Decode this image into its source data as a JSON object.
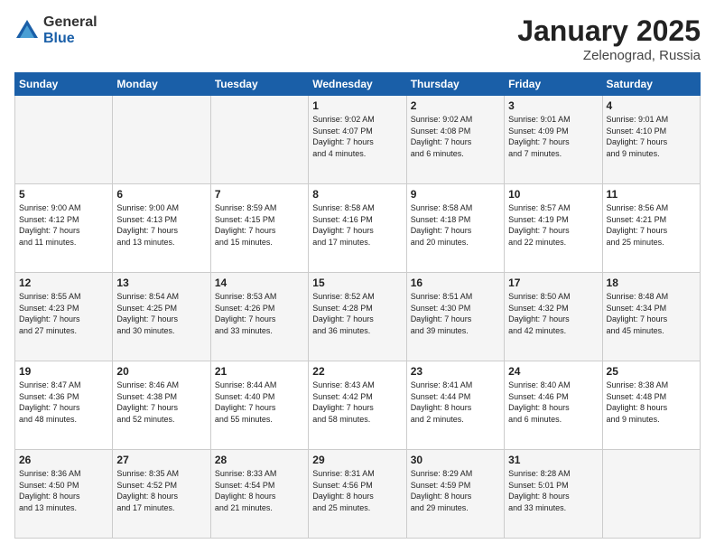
{
  "logo": {
    "general": "General",
    "blue": "Blue"
  },
  "title": "January 2025",
  "location": "Zelenograd, Russia",
  "days_of_week": [
    "Sunday",
    "Monday",
    "Tuesday",
    "Wednesday",
    "Thursday",
    "Friday",
    "Saturday"
  ],
  "weeks": [
    [
      {
        "day": "",
        "info": ""
      },
      {
        "day": "",
        "info": ""
      },
      {
        "day": "",
        "info": ""
      },
      {
        "day": "1",
        "info": "Sunrise: 9:02 AM\nSunset: 4:07 PM\nDaylight: 7 hours\nand 4 minutes."
      },
      {
        "day": "2",
        "info": "Sunrise: 9:02 AM\nSunset: 4:08 PM\nDaylight: 7 hours\nand 6 minutes."
      },
      {
        "day": "3",
        "info": "Sunrise: 9:01 AM\nSunset: 4:09 PM\nDaylight: 7 hours\nand 7 minutes."
      },
      {
        "day": "4",
        "info": "Sunrise: 9:01 AM\nSunset: 4:10 PM\nDaylight: 7 hours\nand 9 minutes."
      }
    ],
    [
      {
        "day": "5",
        "info": "Sunrise: 9:00 AM\nSunset: 4:12 PM\nDaylight: 7 hours\nand 11 minutes."
      },
      {
        "day": "6",
        "info": "Sunrise: 9:00 AM\nSunset: 4:13 PM\nDaylight: 7 hours\nand 13 minutes."
      },
      {
        "day": "7",
        "info": "Sunrise: 8:59 AM\nSunset: 4:15 PM\nDaylight: 7 hours\nand 15 minutes."
      },
      {
        "day": "8",
        "info": "Sunrise: 8:58 AM\nSunset: 4:16 PM\nDaylight: 7 hours\nand 17 minutes."
      },
      {
        "day": "9",
        "info": "Sunrise: 8:58 AM\nSunset: 4:18 PM\nDaylight: 7 hours\nand 20 minutes."
      },
      {
        "day": "10",
        "info": "Sunrise: 8:57 AM\nSunset: 4:19 PM\nDaylight: 7 hours\nand 22 minutes."
      },
      {
        "day": "11",
        "info": "Sunrise: 8:56 AM\nSunset: 4:21 PM\nDaylight: 7 hours\nand 25 minutes."
      }
    ],
    [
      {
        "day": "12",
        "info": "Sunrise: 8:55 AM\nSunset: 4:23 PM\nDaylight: 7 hours\nand 27 minutes."
      },
      {
        "day": "13",
        "info": "Sunrise: 8:54 AM\nSunset: 4:25 PM\nDaylight: 7 hours\nand 30 minutes."
      },
      {
        "day": "14",
        "info": "Sunrise: 8:53 AM\nSunset: 4:26 PM\nDaylight: 7 hours\nand 33 minutes."
      },
      {
        "day": "15",
        "info": "Sunrise: 8:52 AM\nSunset: 4:28 PM\nDaylight: 7 hours\nand 36 minutes."
      },
      {
        "day": "16",
        "info": "Sunrise: 8:51 AM\nSunset: 4:30 PM\nDaylight: 7 hours\nand 39 minutes."
      },
      {
        "day": "17",
        "info": "Sunrise: 8:50 AM\nSunset: 4:32 PM\nDaylight: 7 hours\nand 42 minutes."
      },
      {
        "day": "18",
        "info": "Sunrise: 8:48 AM\nSunset: 4:34 PM\nDaylight: 7 hours\nand 45 minutes."
      }
    ],
    [
      {
        "day": "19",
        "info": "Sunrise: 8:47 AM\nSunset: 4:36 PM\nDaylight: 7 hours\nand 48 minutes."
      },
      {
        "day": "20",
        "info": "Sunrise: 8:46 AM\nSunset: 4:38 PM\nDaylight: 7 hours\nand 52 minutes."
      },
      {
        "day": "21",
        "info": "Sunrise: 8:44 AM\nSunset: 4:40 PM\nDaylight: 7 hours\nand 55 minutes."
      },
      {
        "day": "22",
        "info": "Sunrise: 8:43 AM\nSunset: 4:42 PM\nDaylight: 7 hours\nand 58 minutes."
      },
      {
        "day": "23",
        "info": "Sunrise: 8:41 AM\nSunset: 4:44 PM\nDaylight: 8 hours\nand 2 minutes."
      },
      {
        "day": "24",
        "info": "Sunrise: 8:40 AM\nSunset: 4:46 PM\nDaylight: 8 hours\nand 6 minutes."
      },
      {
        "day": "25",
        "info": "Sunrise: 8:38 AM\nSunset: 4:48 PM\nDaylight: 8 hours\nand 9 minutes."
      }
    ],
    [
      {
        "day": "26",
        "info": "Sunrise: 8:36 AM\nSunset: 4:50 PM\nDaylight: 8 hours\nand 13 minutes."
      },
      {
        "day": "27",
        "info": "Sunrise: 8:35 AM\nSunset: 4:52 PM\nDaylight: 8 hours\nand 17 minutes."
      },
      {
        "day": "28",
        "info": "Sunrise: 8:33 AM\nSunset: 4:54 PM\nDaylight: 8 hours\nand 21 minutes."
      },
      {
        "day": "29",
        "info": "Sunrise: 8:31 AM\nSunset: 4:56 PM\nDaylight: 8 hours\nand 25 minutes."
      },
      {
        "day": "30",
        "info": "Sunrise: 8:29 AM\nSunset: 4:59 PM\nDaylight: 8 hours\nand 29 minutes."
      },
      {
        "day": "31",
        "info": "Sunrise: 8:28 AM\nSunset: 5:01 PM\nDaylight: 8 hours\nand 33 minutes."
      },
      {
        "day": "",
        "info": ""
      }
    ]
  ]
}
